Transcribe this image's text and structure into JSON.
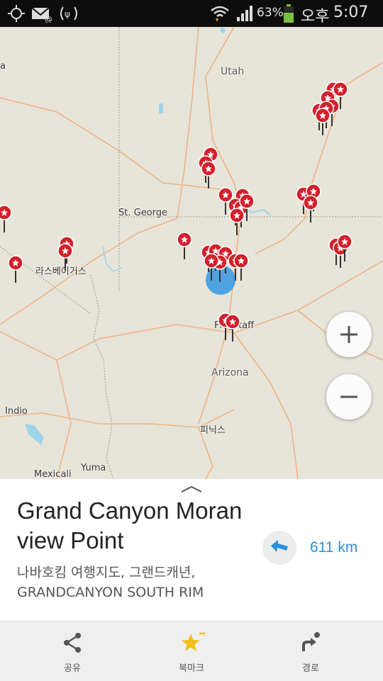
{
  "status_bar": {
    "battery_percent": "63%",
    "time_period": "오후",
    "time": "5:07",
    "battery_level": 0.63,
    "icons": [
      "gps-icon",
      "email-icon",
      "tethering-icon",
      "wifi-icon",
      "signal-icon",
      "battery-icon"
    ]
  },
  "map": {
    "labels": {
      "utah": "Utah",
      "st_george": "St. George",
      "las_vegas": "라스베이거스",
      "flagstaff": "Flagstaff",
      "arizona": "Arizona",
      "indio": "Indio",
      "phoenix": "피닉스",
      "yuma": "Yuma",
      "mexicali": "Mexicali",
      "edge_a": "a"
    },
    "colors": {
      "marker": "#d3202b",
      "road": "#efb27f",
      "water": "#9fd3ea",
      "location": "#3d9be0"
    },
    "zoom_in_icon": "plus-icon",
    "zoom_out_icon": "minus-icon"
  },
  "place": {
    "title": "Grand Canyon Moran view Point",
    "subtitle": "나바호킴 여행지도, 그랜드캐년, GRANDCANYON SOUTH RIM",
    "distance": "611 km"
  },
  "toolbar": {
    "share_label": "공유",
    "bookmark_label": "북마크",
    "route_label": "경로"
  }
}
